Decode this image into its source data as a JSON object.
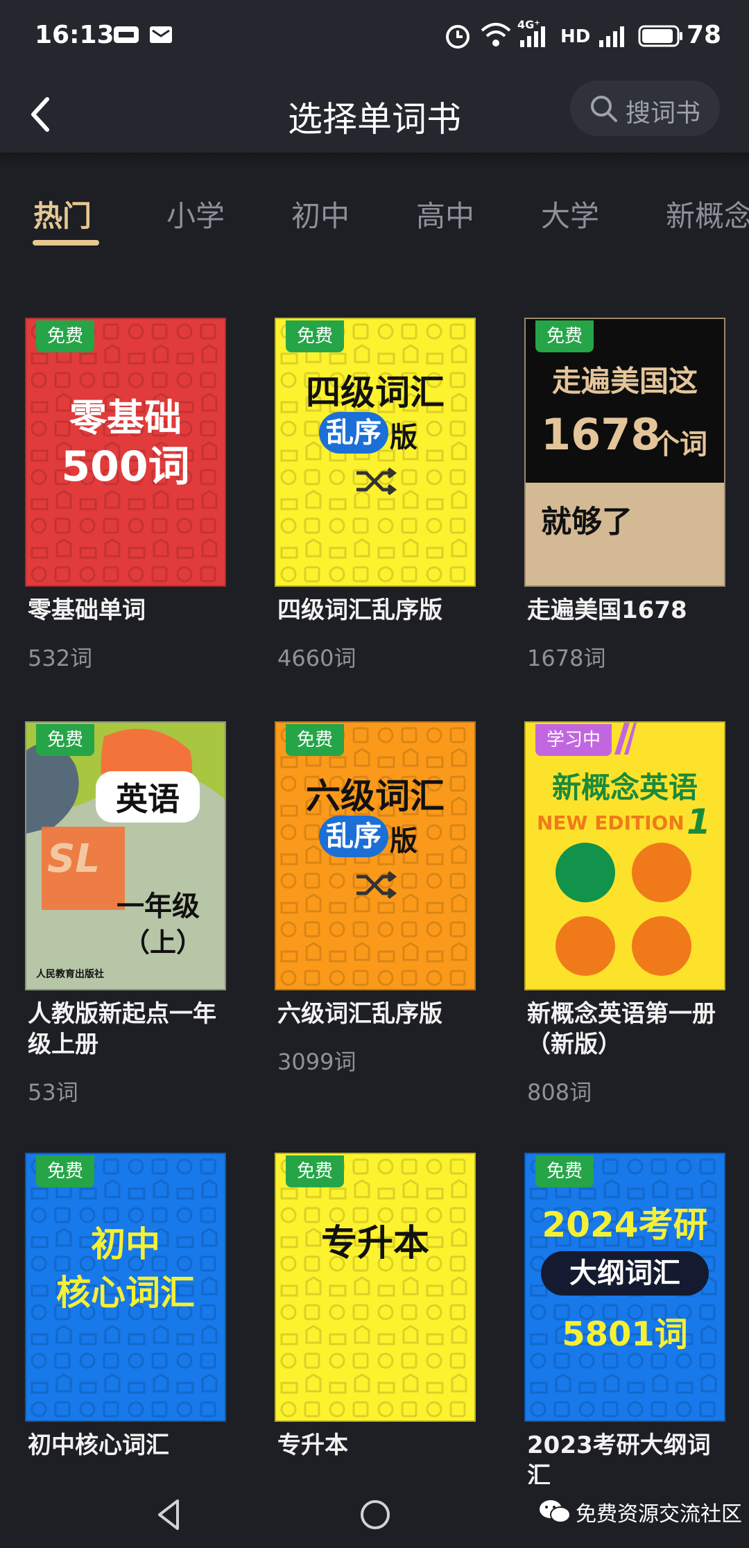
{
  "status_bar": {
    "time": "16:13",
    "signal_label": "4G⁺",
    "hd_label": "HD",
    "battery": "78"
  },
  "header": {
    "title": "选择单词书",
    "search_label": "搜词书"
  },
  "tabs": [
    {
      "label": "热门",
      "active": true
    },
    {
      "label": "小学",
      "active": false
    },
    {
      "label": "初中",
      "active": false
    },
    {
      "label": "高中",
      "active": false
    },
    {
      "label": "大学",
      "active": false
    },
    {
      "label": "新概念",
      "active": false
    }
  ],
  "books": [
    {
      "title": "零基础单词",
      "count": "532词",
      "badge": "免费",
      "cover_bg": "#e23b3b",
      "cover": {
        "line1": "零基础",
        "line2": "500词"
      }
    },
    {
      "title": "四级词汇乱序版",
      "count": "4660词",
      "badge": "免费",
      "cover_bg": "#fdf22e",
      "cover": {
        "line1": "四级词汇",
        "pill": "乱序",
        "suffix": "版"
      }
    },
    {
      "title": "走遍美国1678",
      "count": "1678词",
      "badge": "免费",
      "cover_bg": "#d4b995",
      "cover": {
        "line1": "走遍美国这",
        "line2": "1678",
        "line2b": "个词",
        "line3": "就够了"
      }
    },
    {
      "title": "人教版新起点一年级上册",
      "count": "53词",
      "badge": "免费",
      "cover_bg": "#b8c6a8",
      "cover": {
        "line1": "英语",
        "line2": "SL",
        "line3": "一年级",
        "line4": "（上）",
        "publisher": "人民教育出版社"
      }
    },
    {
      "title": "六级词汇乱序版",
      "count": "3099词",
      "badge": "免费",
      "cover_bg": "#fb9a1a",
      "cover": {
        "line1": "六级词汇",
        "pill": "乱序",
        "suffix": "版"
      }
    },
    {
      "title": "新概念英语第一册（新版）",
      "count": "808词",
      "badge": "学习中",
      "cover_bg": "#fde22c",
      "cover": {
        "line1": "新概念英语",
        "line2": "NEW EDITION",
        "line2b": "1"
      }
    },
    {
      "title": "初中核心词汇",
      "count": "",
      "badge": "免费",
      "cover_bg": "#1779ea",
      "cover": {
        "line1": "初中",
        "line2": "核心词汇"
      }
    },
    {
      "title": "专升本",
      "count": "",
      "badge": "免费",
      "cover_bg": "#fdf22e",
      "cover": {
        "line1": "专升本"
      }
    },
    {
      "title": "2023考研大纲词汇",
      "count": "",
      "badge": "免费",
      "cover_bg": "#1779ea",
      "cover": {
        "line1": "2024考研",
        "pill": "大纲词汇",
        "line3": "5801词"
      }
    }
  ],
  "watermark": "免费资源交流社区",
  "colors": {
    "accent": "#e8c891",
    "background": "#1d1f24",
    "free_badge": "#25a547",
    "learning_badge": "#c266e0"
  }
}
